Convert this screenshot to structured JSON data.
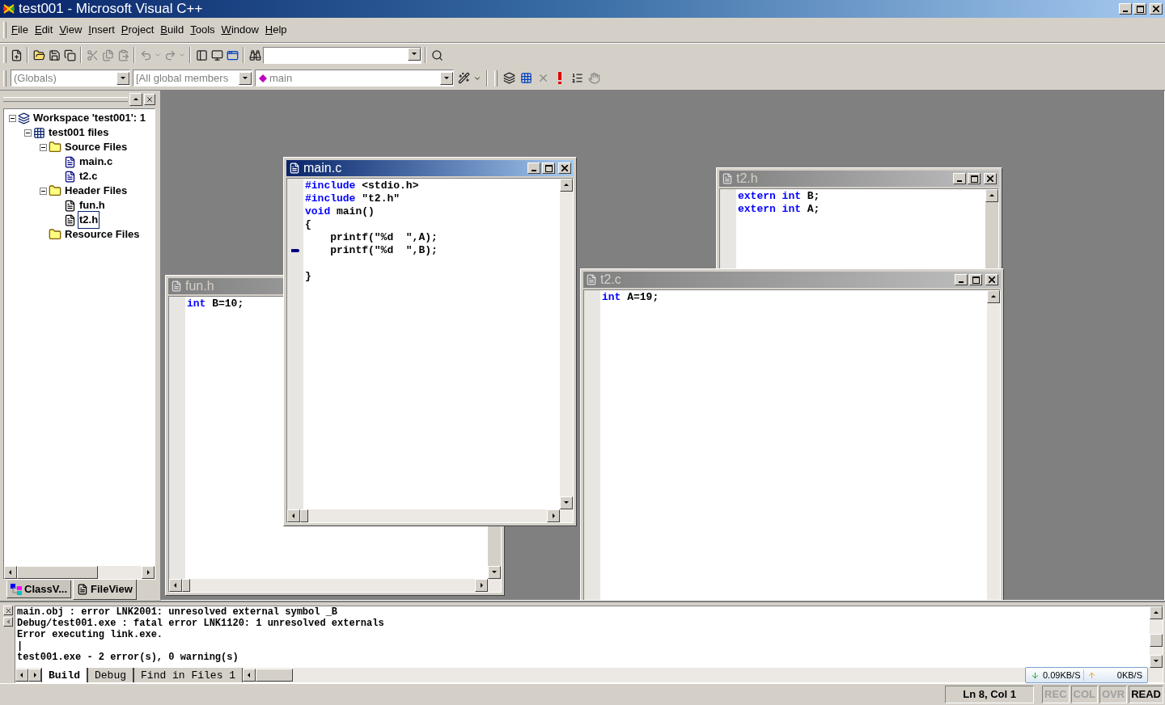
{
  "window": {
    "title": "test001 - Microsoft Visual C++"
  },
  "menu": [
    "File",
    "Edit",
    "View",
    "Insert",
    "Project",
    "Build",
    "Tools",
    "Window",
    "Help"
  ],
  "wizard_bar": [
    {
      "value": "(Globals)",
      "disabled": true
    },
    {
      "value": "[All global members",
      "disabled": true
    },
    {
      "value": "main",
      "disabled": true
    }
  ],
  "workspace": {
    "tree": [
      {
        "label": "Workspace 'test001': 1",
        "kind": "workspace",
        "selected": false,
        "expanded": true,
        "children": [
          {
            "label": "test001 files",
            "kind": "project",
            "selected": false,
            "expanded": true,
            "children": [
              {
                "label": "Source Files",
                "kind": "folder",
                "selected": false,
                "expanded": true,
                "children": [
                  {
                    "label": "main.c",
                    "kind": "source",
                    "selected": false
                  },
                  {
                    "label": "t2.c",
                    "kind": "source",
                    "selected": false
                  }
                ]
              },
              {
                "label": "Header Files",
                "kind": "folder",
                "selected": false,
                "expanded": true,
                "children": [
                  {
                    "label": "fun.h",
                    "kind": "header",
                    "selected": false
                  },
                  {
                    "label": "t2.h",
                    "kind": "header",
                    "selected": true
                  }
                ]
              },
              {
                "label": "Resource Files",
                "kind": "folder",
                "selected": false
              }
            ]
          }
        ]
      }
    ],
    "tabs": [
      {
        "label": "ClassV...",
        "kind": "class",
        "selected": false
      },
      {
        "label": "FileView",
        "kind": "file",
        "selected": true
      }
    ]
  },
  "editors": [
    {
      "title": "fun.h",
      "active": false,
      "lines": [
        {
          "marker": false,
          "segments": [
            {
              "text": "int",
              "kind": "keyword"
            },
            {
              "text": " B=10;",
              "kind": "plain"
            }
          ]
        }
      ]
    },
    {
      "title": "t2.h",
      "active": false,
      "lines": [
        {
          "marker": false,
          "segments": [
            {
              "text": "extern int",
              "kind": "keyword"
            },
            {
              "text": " B;",
              "kind": "plain"
            }
          ]
        },
        {
          "marker": false,
          "segments": [
            {
              "text": "extern int",
              "kind": "keyword"
            },
            {
              "text": " A;",
              "kind": "plain"
            }
          ]
        }
      ]
    },
    {
      "title": "t2.c",
      "active": false,
      "lines": [
        {
          "marker": false,
          "segments": [
            {
              "text": "int",
              "kind": "keyword"
            },
            {
              "text": " A=19;",
              "kind": "plain"
            }
          ]
        }
      ]
    },
    {
      "title": "main.c",
      "active": true,
      "lines": [
        {
          "marker": false,
          "segments": [
            {
              "text": "#include",
              "kind": "keyword"
            },
            {
              "text": " <stdio.h>",
              "kind": "plain"
            }
          ]
        },
        {
          "marker": false,
          "segments": [
            {
              "text": "#include",
              "kind": "keyword"
            },
            {
              "text": " \"t2.h\"",
              "kind": "plain"
            }
          ]
        },
        {
          "marker": false,
          "segments": [
            {
              "text": "void",
              "kind": "keyword"
            },
            {
              "text": " main()",
              "kind": "plain"
            }
          ]
        },
        {
          "marker": false,
          "segments": [
            {
              "text": "{",
              "kind": "plain"
            }
          ]
        },
        {
          "marker": false,
          "segments": [
            {
              "text": "    printf(\"%d  \",A);",
              "kind": "plain"
            }
          ]
        },
        {
          "marker": true,
          "segments": [
            {
              "text": "    printf(\"%d  \",B);",
              "kind": "plain"
            }
          ]
        },
        {
          "marker": false,
          "kind": "blank"
        },
        {
          "marker": false,
          "segments": [
            {
              "text": "}",
              "kind": "plain"
            }
          ]
        }
      ]
    }
  ],
  "output": {
    "lines": [
      "main.obj : error LNK2001: unresolved external symbol _B",
      "Debug/test001.exe : fatal error LNK1120: 1 unresolved externals",
      "Error executing link.exe.",
      "|",
      "test001.exe - 2 error(s), 0 warning(s)"
    ],
    "tabs": [
      {
        "label": "Build",
        "selected": true
      },
      {
        "label": "Debug",
        "selected": false
      },
      {
        "label": "Find in Files 1",
        "selected": false
      }
    ],
    "net": {
      "down": "0.09KB/S",
      "up": "0KB/S"
    }
  },
  "status_bar": {
    "position": "Ln 8, Col 1",
    "indicators": [
      {
        "label": "REC",
        "on": false
      },
      {
        "label": "COL",
        "on": false
      },
      {
        "label": "OVR",
        "on": false
      },
      {
        "label": "READ",
        "on": true
      }
    ]
  }
}
